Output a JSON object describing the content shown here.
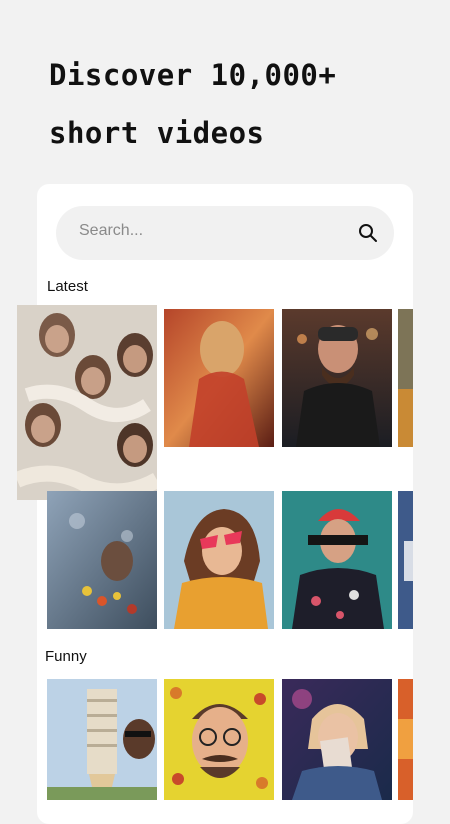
{
  "headline": {
    "line1": "Discover 10,000+",
    "line2": "short videos"
  },
  "search": {
    "placeholder": "Search..."
  },
  "sections": {
    "latest": "Latest",
    "funny": "Funny"
  },
  "icons": {
    "search": "search-icon"
  }
}
